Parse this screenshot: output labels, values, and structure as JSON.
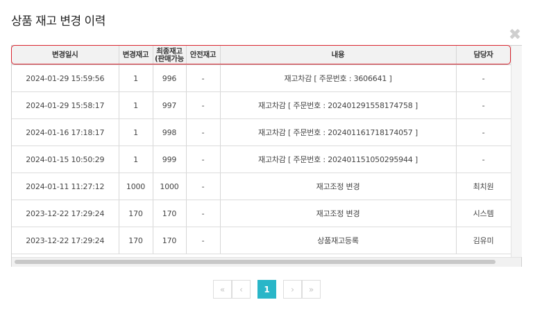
{
  "dialog": {
    "title": "상품 재고 변경 이력",
    "close_icon": "close-icon",
    "close_glyph": "✖"
  },
  "table": {
    "headers": {
      "date": "변경일시",
      "change": "변경재고",
      "final_line1": "최종재고",
      "final_line2": "(판매가능",
      "safety": "안전재고",
      "content": "내용",
      "manager": "담당자"
    },
    "rows": [
      {
        "date": "2024-01-29 15:59:56",
        "change": "1",
        "final": "996",
        "safety": "-",
        "content": "재고차감 [ 주문번호 : 3606641 ]",
        "manager": "-"
      },
      {
        "date": "2024-01-29 15:58:17",
        "change": "1",
        "final": "997",
        "safety": "-",
        "content": "재고차감 [ 주문번호 : 202401291558174758 ]",
        "manager": "-"
      },
      {
        "date": "2024-01-16 17:18:17",
        "change": "1",
        "final": "998",
        "safety": "-",
        "content": "재고차감 [ 주문번호 : 202401161718174057 ]",
        "manager": "-"
      },
      {
        "date": "2024-01-15 10:50:29",
        "change": "1",
        "final": "999",
        "safety": "-",
        "content": "재고차감 [ 주문번호 : 202401151050295944 ]",
        "manager": "-"
      },
      {
        "date": "2024-01-11 11:27:12",
        "change": "1000",
        "final": "1000",
        "safety": "-",
        "content": "재고조정 변경",
        "manager": "최치원"
      },
      {
        "date": "2023-12-22 17:29:24",
        "change": "170",
        "final": "170",
        "safety": "-",
        "content": "재고조정 변경",
        "manager": "시스템"
      },
      {
        "date": "2023-12-22 17:29:24",
        "change": "170",
        "final": "170",
        "safety": "-",
        "content": "상품재고등록",
        "manager": "김유미"
      }
    ]
  },
  "pagination": {
    "first": "«",
    "prev": "‹",
    "current": "1",
    "next": "›",
    "last": "»"
  },
  "colors": {
    "highlight": "#d9232e",
    "active_page": "#29b6c8"
  }
}
